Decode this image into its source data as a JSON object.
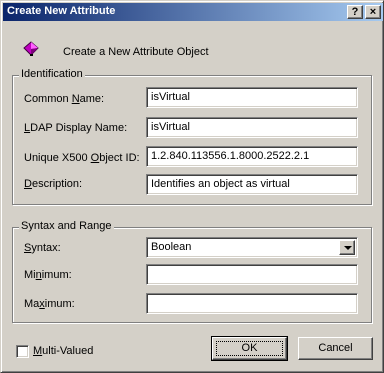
{
  "window": {
    "title": "Create New Attribute",
    "help_glyph": "?",
    "close_glyph": "×"
  },
  "header": {
    "icon": "attribute-object-icon",
    "text": "Create a New Attribute Object"
  },
  "identification": {
    "group_label": "Identification",
    "fields": [
      {
        "label_pre": "Common ",
        "label_key": "N",
        "label_post": "ame:",
        "value": "isVirtual"
      },
      {
        "label_pre": "",
        "label_key": "L",
        "label_post": "DAP Display Name:",
        "value": "isVirtual"
      },
      {
        "label_pre": "Unique X500 ",
        "label_key": "O",
        "label_post": "bject ID:",
        "value": "1.2.840.113556.1.8000.2522.2.1"
      },
      {
        "label_pre": "",
        "label_key": "D",
        "label_post": "escription:",
        "value": "Identifies an object as virtual"
      }
    ]
  },
  "syntax_range": {
    "group_label": "Syntax and Range",
    "syntax": {
      "label_pre": "",
      "label_key": "S",
      "label_post": "yntax:",
      "value": "Boolean"
    },
    "minimum": {
      "label_pre": "Mi",
      "label_key": "n",
      "label_post": "imum:",
      "value": ""
    },
    "maximum": {
      "label_pre": "Ma",
      "label_key": "x",
      "label_post": "imum:",
      "value": ""
    }
  },
  "multi_valued": {
    "label_pre": "",
    "label_key": "M",
    "label_post": "ulti-Valued",
    "checked": false
  },
  "buttons": {
    "ok": "OK",
    "cancel": "Cancel"
  },
  "colors": {
    "title_start": "#0a246a",
    "title_end": "#a6caf0",
    "icon": "#c000c0"
  }
}
